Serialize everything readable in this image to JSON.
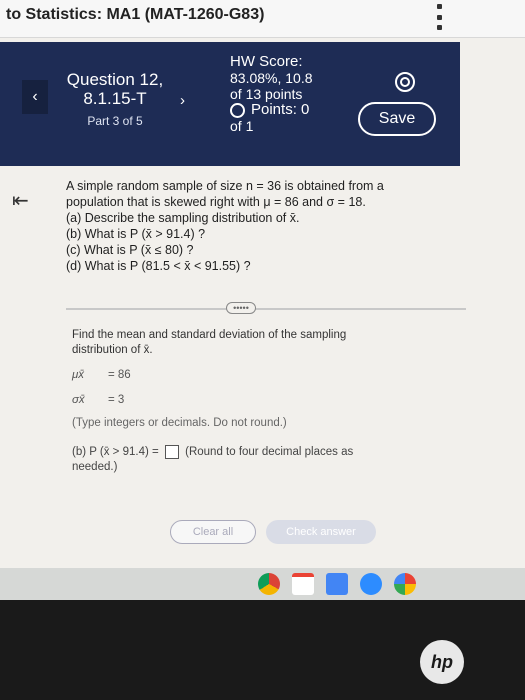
{
  "window": {
    "course_title": "to Statistics: MA1 (MAT-1260-G83)"
  },
  "header": {
    "question_label": "Question 12,",
    "question_number": "8.1.15-T",
    "part": "Part 3 of 5",
    "prev_arrow": "‹",
    "next_arrow": "›",
    "hw_score_label": "HW Score:",
    "hw_score_value": "83.08%, 10.8",
    "hw_score_total": "of 13 points",
    "points_label": "Points: 0",
    "points_total": "of 1",
    "save_label": "Save"
  },
  "problem": {
    "collapse_icon": "⇤",
    "intro_1": "A simple random sample of size n = 36 is obtained from a",
    "intro_2": "population that is skewed right with μ = 86 and σ = 18.",
    "part_a": "(a) Describe the sampling distribution of x̄.",
    "part_b": "(b) What is P (x̄ > 91.4) ?",
    "part_c": "(c) What is P (x̄ ≤ 80) ?",
    "part_d": "(d) What is P (81.5 < x̄ < 91.55) ?",
    "dots": "•••••"
  },
  "answer": {
    "instruction_1": "Find the mean and standard deviation of the sampling",
    "instruction_2": "distribution of x̄.",
    "mu_symbol": "μx̄",
    "mu_value": "= 86",
    "sigma_symbol": "σx̄",
    "sigma_value": "= 3",
    "hint": "(Type integers or decimals. Do not round.)",
    "partb_prefix": "(b) P (x̄ > 91.4) =",
    "partb_suffix": "(Round to four decimal places as",
    "partb_suffix_2": "needed.)"
  },
  "buttons": {
    "clear_all": "Clear all",
    "check_answer": "Check answer"
  },
  "taskbar": {
    "icons": [
      "chrome-icon",
      "gmail-icon",
      "docs-icon",
      "zoom-icon",
      "photos-icon"
    ]
  },
  "device": {
    "logo": "hp"
  }
}
